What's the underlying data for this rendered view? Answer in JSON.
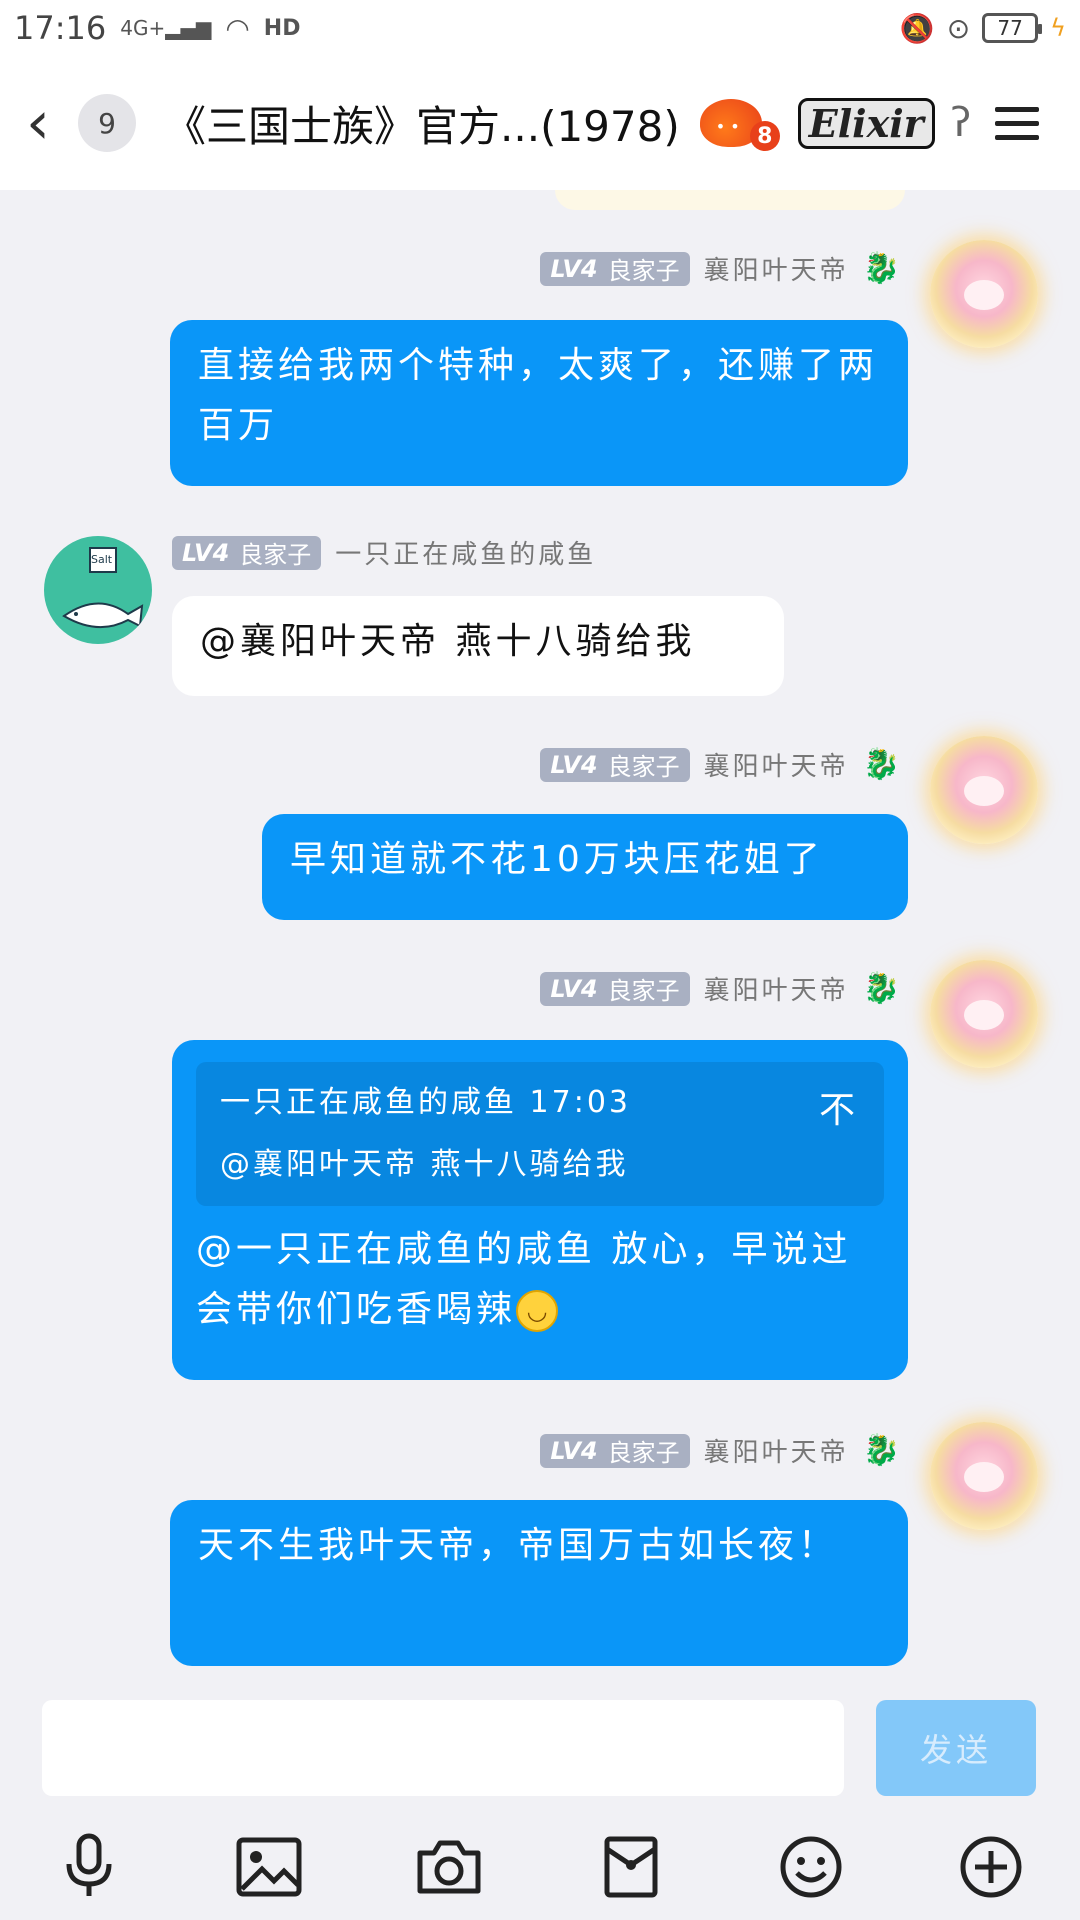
{
  "status_bar": {
    "time": "17:16",
    "network": "4G+",
    "hd": "HD",
    "battery": "77"
  },
  "header": {
    "unread_count": "9",
    "title": "《三国士族》官方...",
    "member_count": "(1978)",
    "fire_level": "8",
    "badge_text": "Elixir"
  },
  "messages": [
    {
      "side": "right",
      "level": "LV4",
      "rank": "良家子",
      "nickname": "襄阳叶天帝",
      "text": "直接给我两个特种，太爽了，还赚了两百万"
    },
    {
      "side": "left",
      "level": "LV4",
      "rank": "良家子",
      "nickname": "一只正在咸鱼的咸鱼",
      "avatar_label": "Salt",
      "text": "@襄阳叶天帝 燕十八骑给我"
    },
    {
      "side": "right",
      "level": "LV4",
      "rank": "良家子",
      "nickname": "襄阳叶天帝",
      "text": "早知道就不花10万块压花姐了"
    },
    {
      "side": "right",
      "level": "LV4",
      "rank": "良家子",
      "nickname": "襄阳叶天帝",
      "quote_author": "一只正在咸鱼的咸鱼 17:03",
      "quote_text": "@襄阳叶天帝 燕十八骑给我",
      "text": "@一只正在咸鱼的咸鱼 放心，早说过会带你们吃香喝辣"
    },
    {
      "side": "right",
      "level": "LV4",
      "rank": "良家子",
      "nickname": "襄阳叶天帝",
      "text": "天不生我叶天帝，帝国万古如长夜！"
    }
  ],
  "composer": {
    "input_value": "",
    "send_label": "发送"
  },
  "toolbar": {
    "icons": [
      "microphone-icon",
      "image-icon",
      "camera-icon",
      "red-packet-icon",
      "emoji-icon",
      "plus-icon"
    ]
  },
  "colors": {
    "bubble_blue": "#0a96f8",
    "quote_blue": "#0887e0",
    "send_disabled": "#83c8f9",
    "level_badge": "#a9b0c2"
  }
}
